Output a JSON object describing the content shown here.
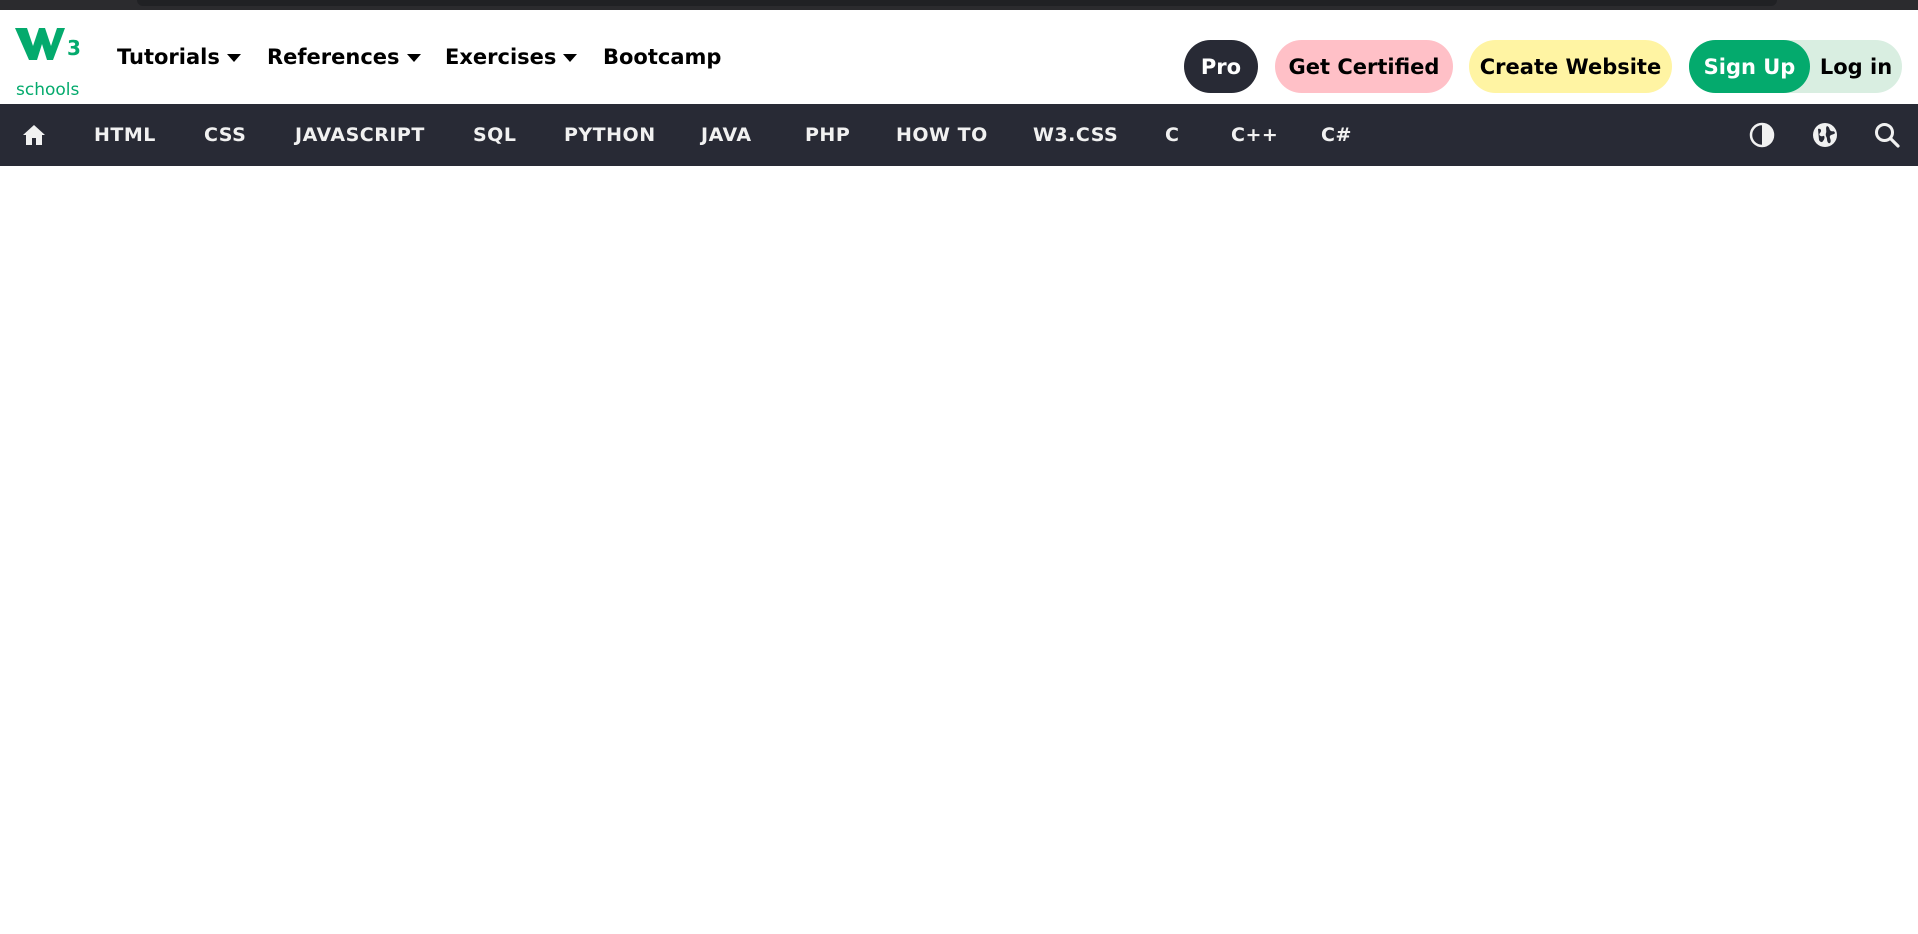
{
  "brand": {
    "logo_mark": "W",
    "logo_sup": "3",
    "logo_text": "schools",
    "color": "#04aa6d"
  },
  "topnav": {
    "menus": [
      {
        "label": "Tutorials",
        "has_dropdown": true
      },
      {
        "label": "References",
        "has_dropdown": true
      },
      {
        "label": "Exercises",
        "has_dropdown": true
      },
      {
        "label": "Bootcamp",
        "has_dropdown": false
      }
    ],
    "buttons": {
      "pro": "Pro",
      "get_certified": "Get Certified",
      "create_website": "Create Website",
      "sign_up": "Sign Up",
      "log_in": "Log in"
    }
  },
  "subnav": {
    "home_icon": "home-icon",
    "links": [
      "HTML",
      "CSS",
      "JAVASCRIPT",
      "SQL",
      "PYTHON",
      "JAVA",
      "PHP",
      "HOW TO",
      "W3.CSS",
      "C",
      "C++",
      "C#"
    ],
    "icons": [
      "contrast-icon",
      "globe-icon",
      "search-icon"
    ]
  },
  "colors": {
    "nav_bg": "#282a35",
    "pro_bg": "#282a35",
    "certified_bg": "#ffc0c7",
    "website_bg": "#fff4a3",
    "signup_bg": "#04aa6d",
    "login_bg": "#d9eee1"
  }
}
